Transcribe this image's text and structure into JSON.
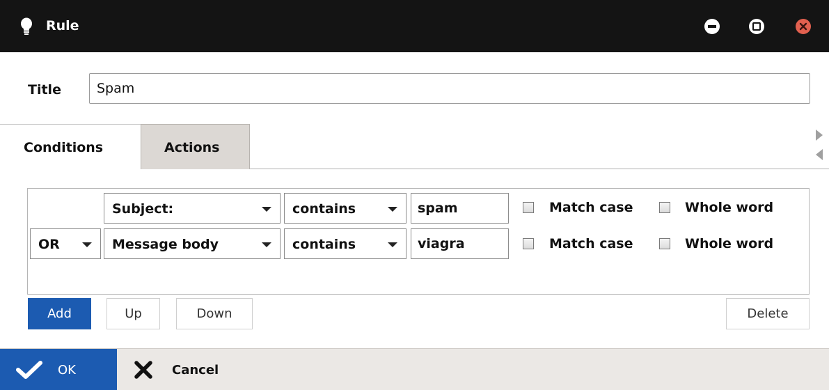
{
  "window": {
    "title": "Rule",
    "icon": "lightbulb-icon",
    "controls": [
      "minimize-icon",
      "maximize-icon",
      "close-icon"
    ],
    "close_color": "#e2604f"
  },
  "title_field": {
    "label": "Title",
    "value": "Spam"
  },
  "tabs": [
    {
      "label": "Conditions",
      "active": true
    },
    {
      "label": "Actions",
      "active": false
    }
  ],
  "conditions": [
    {
      "operator": "",
      "field": "Subject:",
      "comparison": "contains",
      "value": "spam",
      "match_case_label": "Match case",
      "match_case": false,
      "whole_word_label": "Whole word",
      "whole_word": false
    },
    {
      "operator": "OR",
      "field": "Message body",
      "comparison": "contains",
      "value": "viagra",
      "match_case_label": "Match case",
      "match_case": false,
      "whole_word_label": "Whole word",
      "whole_word": false
    }
  ],
  "condition_buttons": {
    "add": "Add",
    "up": "Up",
    "down": "Down",
    "delete": "Delete"
  },
  "footer": {
    "ok": "OK",
    "cancel": "Cancel"
  },
  "colors": {
    "titlebar": "#141414",
    "accent": "#1c5bb1",
    "footer": "#ebe8e5",
    "inactive_tab": "#dcd8d4"
  }
}
